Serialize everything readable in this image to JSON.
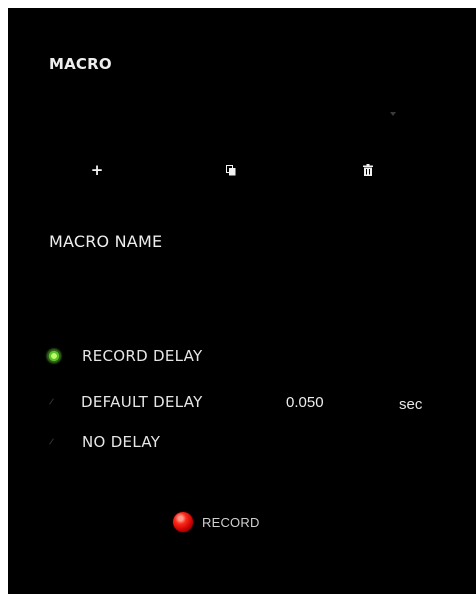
{
  "macro": {
    "title": "MACRO",
    "toolbar": {
      "add_icon": "plus-icon",
      "add_glyph": "+",
      "copy_icon": "copy-icon",
      "delete_icon": "trash-icon"
    }
  },
  "macro_name": {
    "title": "MACRO NAME"
  },
  "delay_options": {
    "record_delay": {
      "label": "RECORD DELAY",
      "selected": true
    },
    "default_delay": {
      "label": "DEFAULT DELAY",
      "selected": false,
      "value": "0.050",
      "unit": "sec"
    },
    "no_delay": {
      "label": "NO DELAY",
      "selected": false
    }
  },
  "record": {
    "label": "RECORD",
    "icon": "record-icon"
  },
  "colors": {
    "background": "#000000",
    "text": "#e8e8e8",
    "radio_active": "#5bbf2a",
    "record_red": "#e00000"
  }
}
